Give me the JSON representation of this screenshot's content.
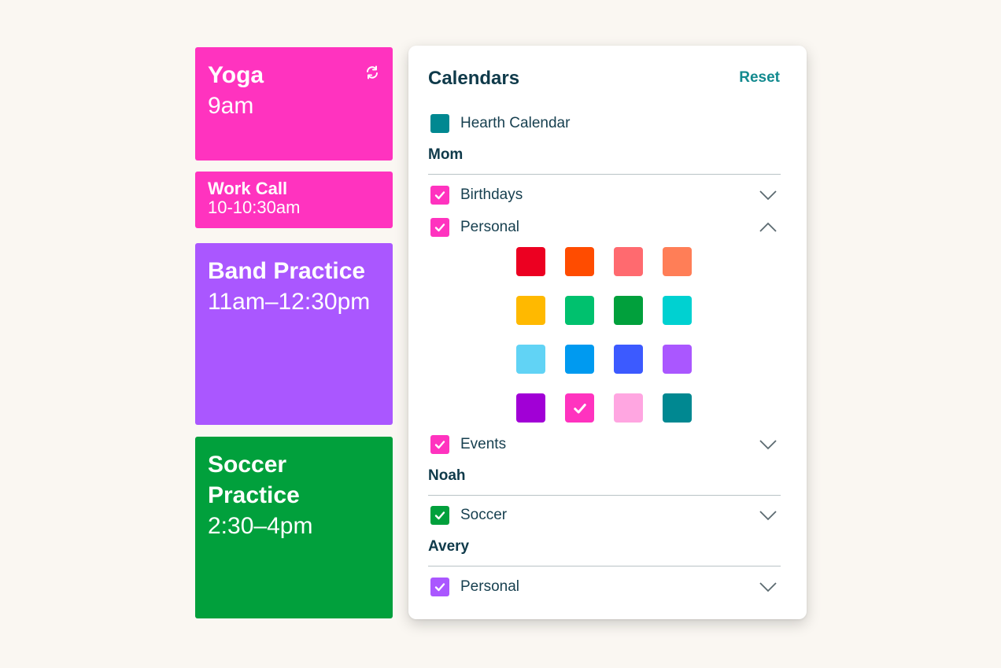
{
  "events": [
    {
      "title": "Yoga",
      "time": "9am",
      "color": "#ff33bf",
      "recurring": true,
      "icon": "sync-icon"
    },
    {
      "title": "Work Call",
      "time": "10-10:30am",
      "color": "#ff33bf"
    },
    {
      "title": "Band Practice",
      "time": "11am–12:30pm",
      "color": "#aa57ff"
    },
    {
      "title": "Soccer Practice",
      "time": "2:30–4pm",
      "color": "#01a03c"
    }
  ],
  "panel": {
    "title": "Calendars",
    "reset_label": "Reset",
    "hearth": {
      "label": "Hearth Calendar",
      "color": "#008891"
    },
    "groups": [
      {
        "name": "Mom",
        "calendars": [
          {
            "label": "Birthdays",
            "checked": true,
            "color": "#ff33bf",
            "expanded": false,
            "icon": "chevron-down-icon"
          },
          {
            "label": "Personal",
            "checked": true,
            "color": "#ff33bf",
            "expanded": true,
            "icon": "chevron-up-icon"
          },
          {
            "label": "Events",
            "checked": true,
            "color": "#ff33bf",
            "expanded": false,
            "icon": "chevron-down-icon"
          }
        ]
      },
      {
        "name": "Noah",
        "calendars": [
          {
            "label": "Soccer",
            "checked": true,
            "color": "#01a03c",
            "expanded": false,
            "icon": "chevron-down-icon"
          }
        ]
      },
      {
        "name": "Avery",
        "calendars": [
          {
            "label": "Personal",
            "checked": true,
            "color": "#aa57ff",
            "expanded": false,
            "icon": "chevron-down-icon"
          }
        ]
      }
    ],
    "palette": {
      "selected": "#ff33bf",
      "colors": [
        "#ec0021",
        "#ff4c00",
        "#ff6a6f",
        "#ff7e57",
        "#ffb900",
        "#00c16e",
        "#01a03c",
        "#00d1d1",
        "#61d3f5",
        "#009af0",
        "#3c5aff",
        "#aa57ff",
        "#a100d6",
        "#ff33bf",
        "#ffa6e1",
        "#008891"
      ]
    }
  }
}
